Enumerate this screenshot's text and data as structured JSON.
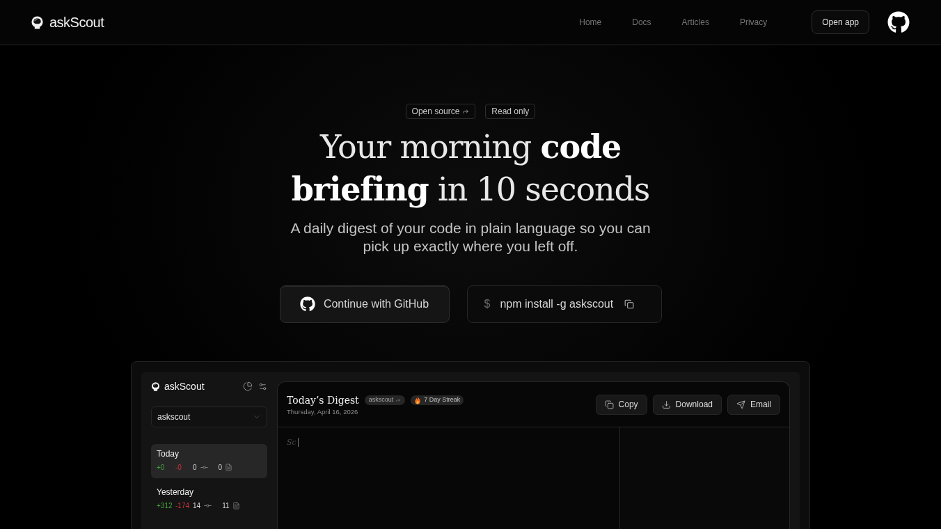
{
  "header": {
    "brand": "askScout",
    "nav": [
      {
        "label": "Home"
      },
      {
        "label": "Docs"
      },
      {
        "label": "Articles"
      },
      {
        "label": "Privacy"
      }
    ],
    "action": "Open app"
  },
  "hero": {
    "badges": [
      {
        "label": "Open source",
        "kind": "link"
      },
      {
        "label": "Read only",
        "kind": "plain"
      }
    ],
    "headline": "Your morning **code briefing** in 10 seconds",
    "subtitle": "A daily digest of your code in plain language so you can pick up exactly where you left off.",
    "github_button": "Continue with GitHub",
    "command": {
      "prompt": "$",
      "text": "npm install -g askscout"
    }
  },
  "preview": {
    "sidebar": {
      "brand": "askScout",
      "repo": "askscout",
      "days": [
        {
          "label": "Today",
          "selected": true,
          "additions": "+0",
          "deletions": "-0",
          "commits": "0",
          "files": "0"
        },
        {
          "label": "Yesterday",
          "selected": false,
          "additions": "+312",
          "deletions": "-174",
          "commits": "14",
          "files": "11"
        }
      ]
    },
    "digest": {
      "title": "Today’s Digest",
      "repo_tag": "askscout",
      "streak": "7 Day Streak",
      "date": "Thursday, April 16, 2026",
      "actions": [
        {
          "label": "Copy",
          "kind": "copy"
        },
        {
          "label": "Download",
          "kind": "download"
        },
        {
          "label": "Email",
          "kind": "email"
        }
      ],
      "typed_text": "Sc"
    }
  }
}
